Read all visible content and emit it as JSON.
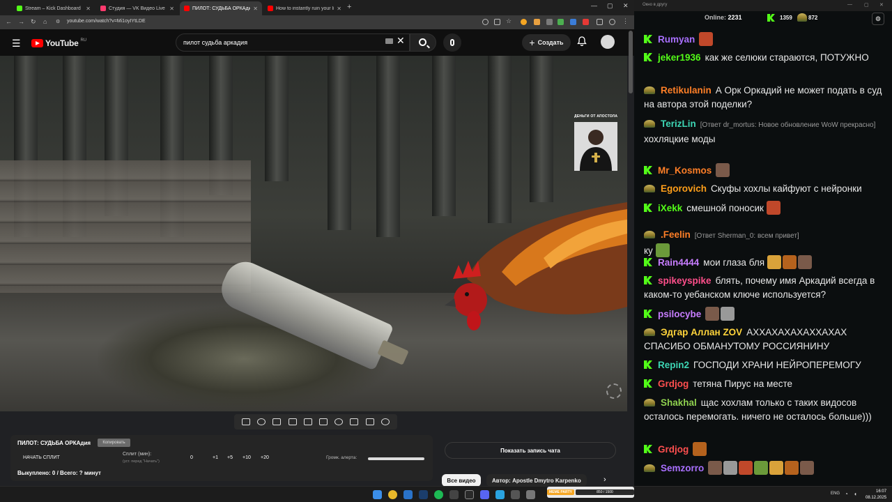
{
  "browser": {
    "tabs": [
      {
        "title": "Stream – Kick Dashboard",
        "color": "#53fc18"
      },
      {
        "title": "Студия — VK Видео Live",
        "color": "#ff3a6e"
      },
      {
        "title": "ПИЛОТ: СУДЬБА ОРКАдия - Yo",
        "color": "#ff0000"
      },
      {
        "title": "How to instantly ruin your life",
        "color": "#ff0000"
      }
    ],
    "url": "youtube.com/watch?v=Mi1oyIYtLDE"
  },
  "youtube": {
    "logo_text": "YouTube",
    "logo_region": "RU",
    "search_value": "пилот судьба аркадия",
    "create_label": "Создать",
    "watermark_text": "ДЕНЬГИ ОТ АПОСТОЛА"
  },
  "split_panel": {
    "title": "ПИЛОТ: СУДЬБА ОРКАдия",
    "copy_label": "Копировать",
    "start_label": "НАЧАТЬ СПЛИТ",
    "split_label": "Сплит (мин):",
    "split_hint": "(уст. перед \"Начать\")",
    "split_value": "0",
    "increments": [
      "+1",
      "+5",
      "+10",
      "+20"
    ],
    "volume_label": "Громк. алерта:",
    "bought_text": "Выкуплено: 0 / Всего: ? минут"
  },
  "below_video": {
    "show_chat_label": "Показать запись чата",
    "all_videos_label": "Все видео",
    "author_label": "Автор: Apostle Dmytro Karpenko"
  },
  "chat_window": {
    "title": "Окно в другу",
    "online_label": "Online:",
    "online_count": "2231",
    "kick_count": "1359",
    "hat_count": "872"
  },
  "chat": [
    {
      "badge": "k",
      "nick": "Rumyan",
      "color": "#a970ff",
      "text": "",
      "emotes": 1
    },
    {
      "badge": "k",
      "nick": "jeker1936",
      "color": "#53fc18",
      "text": "как же селюки стараются, ПОТУЖНО",
      "emotes": 0
    },
    {
      "badge": "h",
      "nick": "Retikulanin",
      "color": "#ff7f27",
      "text": "А Орк Оркадий не может подать в суд на автора этой поделки?",
      "emotes": 0
    },
    {
      "badge": "h",
      "nick": "TerizLin",
      "color": "#3dd5b4",
      "reply": "[Ответ dr_mortus: Новое обновление WoW прекрасно]",
      "text": "хохляцкие моды",
      "emotes": 0
    },
    {
      "badge": "k",
      "nick": "Mr_Kosmos",
      "color": "#ff7f27",
      "text": "",
      "emotes": 1
    },
    {
      "badge": "h",
      "nick": "Egorovich",
      "color": "#ff9f1a",
      "text": "Скуфы хохлы кайфуют с нейронки",
      "emotes": 0
    },
    {
      "badge": "k",
      "nick": "iXekk",
      "color": "#53fc18",
      "text": "смешной поносик",
      "emotes": 1
    },
    {
      "badge": "h",
      "nick": ".Feelin",
      "color": "#ff7f27",
      "reply": "[Ответ Sherman_0: всем привет]",
      "text": "ку",
      "emotes": 1
    },
    {
      "badge": "k",
      "nick": "Rain4444",
      "color": "#c77dff",
      "text": "мои глаза бля",
      "emotes": 3
    },
    {
      "badge": "k",
      "nick": "spikeyspike",
      "color": "#ff4f8b",
      "text": "блять, почему имя Аркадий всегда в каком-то уебанском ключе используется?",
      "emotes": 0
    },
    {
      "badge": "k",
      "nick": "psilocybe",
      "color": "#c77dff",
      "text": "",
      "emotes": 2
    },
    {
      "badge": "h",
      "nick": "Эдгар Аллан ZOV",
      "color": "#ffd43b",
      "text": "АХХАХАХАХАХХАХАХ СПАСИБО ОБМАНУТОМУ РОССИЯНИНУ",
      "emotes": 0
    },
    {
      "badge": "k",
      "nick": "Repin2",
      "color": "#3dd5b4",
      "text": "ГОСПОДИ ХРАНИ НЕЙРОПЕРЕМОГУ",
      "emotes": 0
    },
    {
      "badge": "k",
      "nick": "Grdjog",
      "color": "#ff4f4f",
      "text": "тетяна Пирус на месте",
      "emotes": 0
    },
    {
      "badge": "h",
      "nick": "Shakhal",
      "color": "#8fd14f",
      "text": "щас хохлам только с таких видосов осталось перемогать. ничего не осталось больше)))",
      "emotes": 0
    },
    {
      "badge": "k",
      "nick": "Grdjog",
      "color": "#ff4f4f",
      "text": "",
      "emotes": 1
    },
    {
      "badge": "h",
      "nick": "Semzorro",
      "color": "#a970ff",
      "text": "",
      "emotes": 7
    }
  ],
  "taskbar": {
    "lang": "ENG",
    "time": "16:07",
    "date": "08.12.2025",
    "widget_label": "MEME PARTY",
    "widget_value": "850 / 1500"
  }
}
